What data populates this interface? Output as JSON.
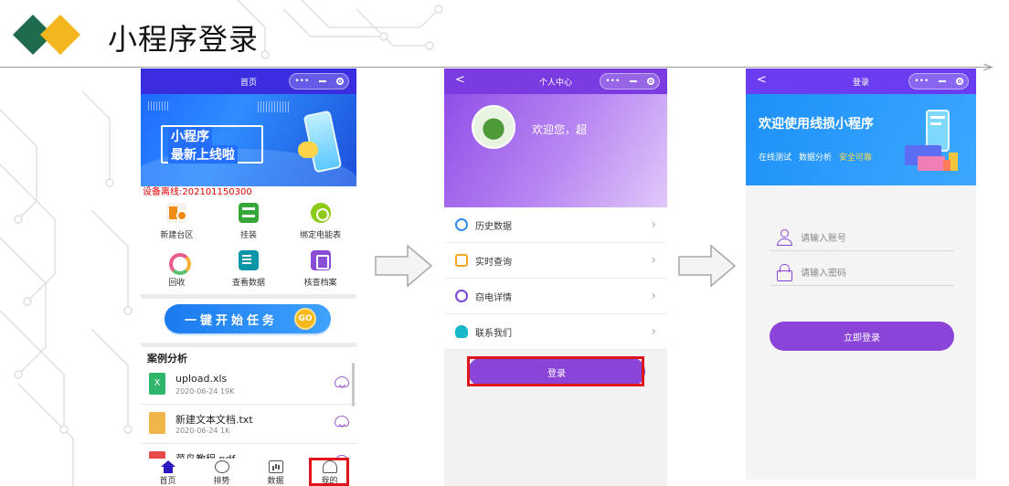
{
  "slide": {
    "title": "小程序登录"
  },
  "phone1": {
    "nav_title": "首页",
    "banner": {
      "line1": "小程序",
      "line2": "最新上线啦"
    },
    "device_offline": "设备离线:202101150300",
    "grid": [
      {
        "label": "新建台区",
        "icon": "building-icon"
      },
      {
        "label": "挂装",
        "icon": "mount-icon"
      },
      {
        "label": "绑定电能表",
        "icon": "link-icon"
      },
      {
        "label": "回收",
        "icon": "recycle-icon"
      },
      {
        "label": "查看数据",
        "icon": "view-data-icon"
      },
      {
        "label": "核查档案",
        "icon": "archive-icon"
      }
    ],
    "cta_label": "一键开始任务",
    "cta_go": "GO",
    "cases_title": "案例分析",
    "files": [
      {
        "name": "upload.xls",
        "meta": "2020-06-24 19K",
        "badge": "X"
      },
      {
        "name": "新建文本文档.txt",
        "meta": "2020-06-24 1K",
        "badge": ""
      },
      {
        "name": "菜鸟教程.pdf",
        "meta": "",
        "badge": ""
      }
    ],
    "tabs": [
      {
        "label": "首页",
        "icon": "home-icon"
      },
      {
        "label": "排势",
        "icon": "ranking-icon"
      },
      {
        "label": "数据",
        "icon": "chart-icon"
      },
      {
        "label": "我的",
        "icon": "user-icon"
      }
    ]
  },
  "phone2": {
    "back": "<",
    "nav_title": "个人中心",
    "welcome": "欢迎您，超",
    "menu": [
      {
        "label": "历史数据",
        "icon": "history-icon"
      },
      {
        "label": "实时查询",
        "icon": "realtime-icon"
      },
      {
        "label": "窃电详情",
        "icon": "theft-icon"
      },
      {
        "label": "联系我们",
        "icon": "contact-icon"
      }
    ],
    "login_button": "登录"
  },
  "phone3": {
    "back": "<",
    "nav_title": "登录",
    "banner_title": "欢迎使用线损小程序",
    "tags": [
      "在线测试",
      "数据分析",
      "安全可靠"
    ],
    "account_placeholder": "请输入账号",
    "password_placeholder": "请输入密码",
    "login_button": "立即登录"
  },
  "capsule": {
    "more": "•••",
    "minimize": "—"
  },
  "colors": {
    "nav_blue": "#3a2de0",
    "purple": "#8a45d8",
    "highlight_red": "#e0151b"
  }
}
